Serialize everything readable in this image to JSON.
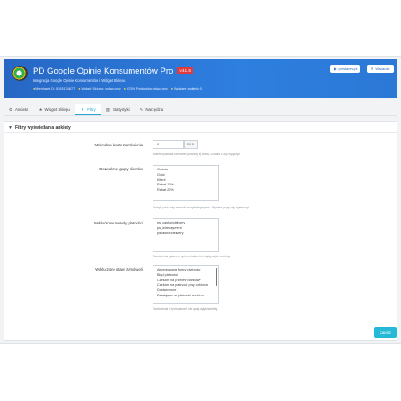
{
  "header": {
    "title": "PD Google Opinie Konsumentów Pro",
    "version": "v4.1.6",
    "subtitle": "Integracja Google Opinie Konsumentów i Widget Sklepu",
    "status": [
      {
        "label": "Merchant ID: 5393174677"
      },
      {
        "label": "Widget Sklepu: wyłączony"
      },
      {
        "label": "GTIN Produktów: włączony"
      },
      {
        "label": "Wysłane ankiety: 0"
      }
    ],
    "buttons": {
      "prestadev": "prestadev.pl",
      "help": "Wsparcie"
    }
  },
  "tabs": [
    {
      "label": "Ankieta",
      "icon": "gear-icon"
    },
    {
      "label": "Widget Sklepu",
      "icon": "star-icon"
    },
    {
      "label": "Filtry",
      "icon": "filter-icon",
      "active": true
    },
    {
      "label": "Statystyki",
      "icon": "bar-chart-icon"
    },
    {
      "label": "Narzędzia",
      "icon": "wrench-icon"
    }
  ],
  "panel": {
    "title": "Filtry wyświetlania ankiety",
    "min_amount": {
      "label": "Minimalna kwota zamówienia",
      "value": "0",
      "currency": "PLN",
      "help": "Ankieta tylko dla zamówień powyżej tej kwoty. Zostaw 0 aby wyłączyć."
    },
    "customer_groups": {
      "label": "Dozwolone grupy klientów",
      "options": [
        "Gościa",
        "Gość",
        "Klient",
        "Rabat 10%",
        "Rabat 20%"
      ],
      "help": "Dodaje pusta aby zezwolić wszystkim grupom. Wybierz grupy aby ograniczyć."
    },
    "payment_methods": {
      "label": "Wykluczone metody płatności",
      "options": [
        "ps_cashondelivery",
        "ps_wirepayment",
        "pdcashondelivery"
      ],
      "help": "Zamówienia opłacone tymi metodami nie będą objęte ankietą."
    },
    "order_states": {
      "label": "Wykluczone stany zamówień",
      "options": [
        "Akceptowane formy płatności",
        "Błąd płatności",
        "Czekam na przelew bankowy",
        "Czekam na płatność przy odbiorze",
        "Dostarczone",
        "Działająca na płatność czekiem"
      ],
      "help": "Zamówienia w tych stanach nie będą objęte ankietą."
    },
    "save_label": "Zapisz"
  },
  "colors": {
    "header": "#2e7fe0",
    "accent": "#25a8d8",
    "save": "#25b9d7",
    "version_badge": "#e0393e"
  }
}
